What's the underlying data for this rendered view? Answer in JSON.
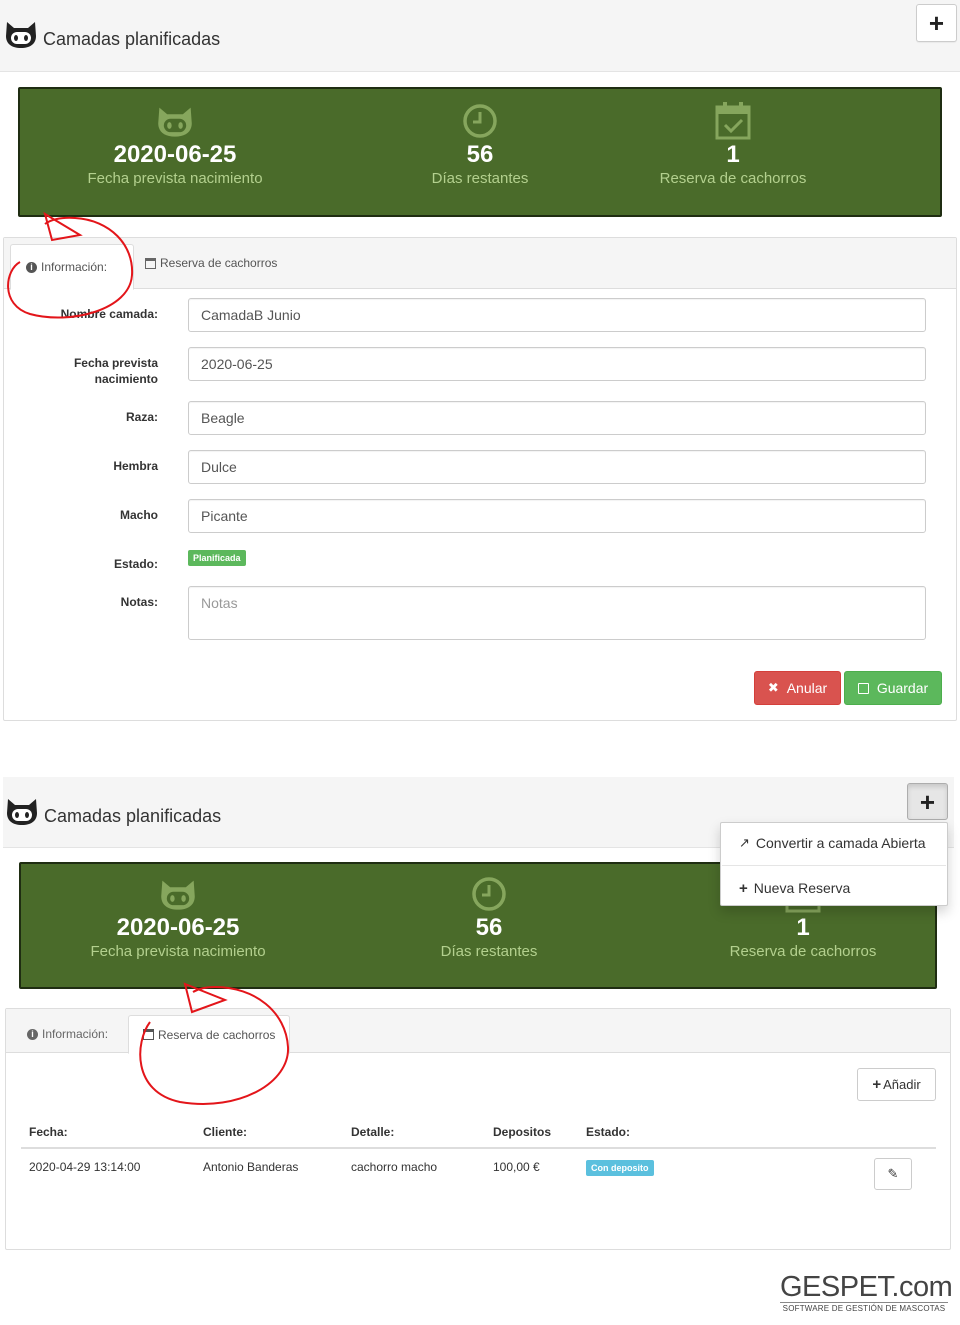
{
  "screen1": {
    "header": {
      "title": "Camadas planificadas",
      "add_icon": "plus-icon"
    },
    "stats": [
      {
        "icon": "cat-icon",
        "value": "2020-06-25",
        "label": "Fecha prevista nacimiento"
      },
      {
        "icon": "clock-icon",
        "value": "56",
        "label": "Días restantes"
      },
      {
        "icon": "calendar-check-icon",
        "value": "1",
        "label": "Reserva de cachorros"
      }
    ],
    "tabs": [
      {
        "icon": "info-circle-icon",
        "label": "Información:"
      },
      {
        "icon": "calendar-icon",
        "label": "Reserva de cachorros"
      }
    ],
    "form": {
      "nombre_label": "Nombre camada:",
      "nombre_value": "CamadaB Junio",
      "fecha_label_1": "Fecha prevista",
      "fecha_label_2": "nacimiento",
      "fecha_value": "2020-06-25",
      "raza_label": "Raza:",
      "raza_value": "Beagle",
      "hembra_label": "Hembra",
      "hembra_value": "Dulce",
      "macho_label": "Macho",
      "macho_value": "Picante",
      "estado_label": "Estado:",
      "estado_badge": "Planificada",
      "notas_label": "Notas:",
      "notas_placeholder": "Notas"
    },
    "buttons": {
      "anular": "Anular",
      "guardar": "Guardar"
    }
  },
  "screen2": {
    "header": {
      "title": "Camadas planificadas",
      "add_icon": "plus-icon"
    },
    "dropdown": [
      {
        "icon": "share-icon",
        "label": "Convertir a camada Abierta"
      },
      {
        "icon": "plus-icon",
        "label": "Nueva Reserva"
      }
    ],
    "stats": [
      {
        "icon": "cat-icon",
        "value": "2020-06-25",
        "label": "Fecha prevista nacimiento"
      },
      {
        "icon": "clock-icon",
        "value": "56",
        "label": "Días restantes"
      },
      {
        "icon": "calendar-check-icon",
        "value": "1",
        "label": "Reserva de cachorros"
      }
    ],
    "tabs": [
      {
        "icon": "info-circle-icon",
        "label": "Información:"
      },
      {
        "icon": "calendar-icon",
        "label": "Reserva de cachorros"
      }
    ],
    "add_button": "Añadir",
    "table": {
      "headers": [
        "Fecha:",
        "Cliente:",
        "Detalle:",
        "Depositos",
        "Estado:"
      ],
      "rows": [
        {
          "fecha": "2020-04-29 13:14:00",
          "cliente": "Antonio Banderas",
          "detalle": "cachorro macho",
          "deposito": "100,00 €",
          "estado": "Con deposito"
        }
      ]
    }
  },
  "brand": {
    "name": "GESPET.com",
    "tagline": "SOFTWARE DE GESTIÓN DE MASCOTAS"
  },
  "colors": {
    "panel_green": "#4a6b2a",
    "stat_sub": "#b3d08e",
    "annotation_red": "#e3151a",
    "danger": "#d9534f",
    "success": "#5cb85c",
    "info": "#5bc0de"
  }
}
